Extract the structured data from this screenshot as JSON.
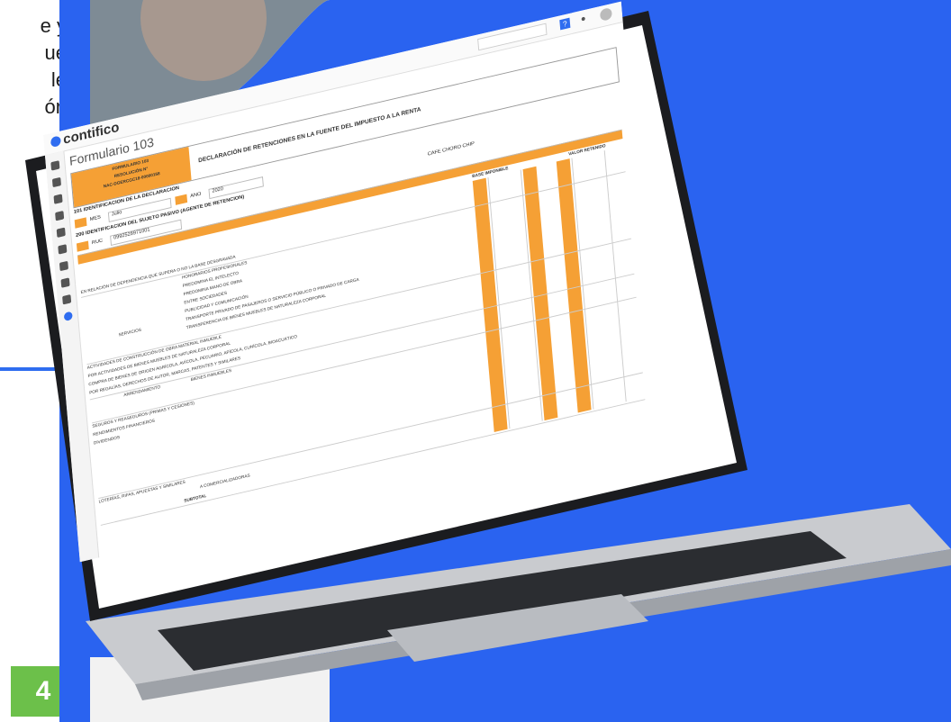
{
  "slide": {
    "intro_lines": [
      "e y",
      "ue",
      "le",
      "ón"
    ],
    "step_number": "4"
  },
  "colors": {
    "brand_blue": "#2f6df0",
    "form_orange": "#f5a035",
    "step_green": "#6cc04a"
  },
  "app": {
    "brand": "contifico",
    "page_title": "Formulario 103",
    "help_icon": "?",
    "icons": [
      "help-icon",
      "bell-icon",
      "avatar-icon"
    ]
  },
  "form": {
    "header_left": [
      "FORMULARIO 103",
      "RESOLUCIÓN N°",
      "NAC-DGERCGC18-00000158"
    ],
    "title": "DECLARACIÓN DE RETENCIONES EN LA FUENTE DEL IMPUESTO A LA RENTA",
    "mes_label": "MES",
    "mes_value": "Julio",
    "anio_label": "AÑO",
    "anio_value": "2020",
    "section_101": "101 IDENTIFICACIÓN DE LA DECLARACIÓN",
    "section_200": "200 IDENTIFICACIÓN DEL SUJETO PASIVO (AGENTE DE RETENCIÓN)",
    "ruc_label": "RUC",
    "ruc_value": "0992528971001",
    "razon_social": "CAFE CHORO CHIP",
    "col_base": "BASE IMPONIBLE",
    "col_valor": "VALOR RETENIDO",
    "row_labels": [
      "EN RELACIÓN DE DEPENDENCIA QUE SUPERA O NO LA BASE DESGRAVADA",
      "HONORARIOS PROFESIONALES",
      "PREDOMINA EL INTELECTO",
      "PREDOMINA MANO DE OBRA",
      "ENTRE SOCIEDADES",
      "PUBLICIDAD Y COMUNICACIÓN",
      "TRANSPORTE PRIVADO DE PASAJEROS O SERVICIO PÚBLICO O PRIVADO DE CARGA",
      "TRANSFERENCIA DE BIENES MUEBLES DE NATURALEZA CORPORAL",
      "SERVICIOS",
      "ACTIVIDADES DE CONSTRUCCIÓN DE OBRA MATERIAL INMUEBLE",
      "POR ACTIVIDADES DE BIENES MUEBLES DE NATURALEZA CORPORAL",
      "COMPRA DE BIENES DE ORIGEN AGRÍCOLA, AVÍCOLA, PECUARIO, APÍCOLA, CUNÍCOLA, BIOACUÁTICO",
      "POR REGALÍAS, DERECHOS DE AUTOR, MARCAS, PATENTES Y SIMILARES",
      "ARRENDAMIENTO",
      "BIENES INMUEBLES",
      "SEGUROS Y REASEGUROS (PRIMAS Y CESIONES)",
      "RENDIMIENTOS FINANCIEROS",
      "DIVIDENDOS",
      "LOTERÍAS, RIFAS, APUESTAS Y SIMILARES",
      "A COMERCIALIZADORAS",
      "SUBTOTAL"
    ]
  }
}
